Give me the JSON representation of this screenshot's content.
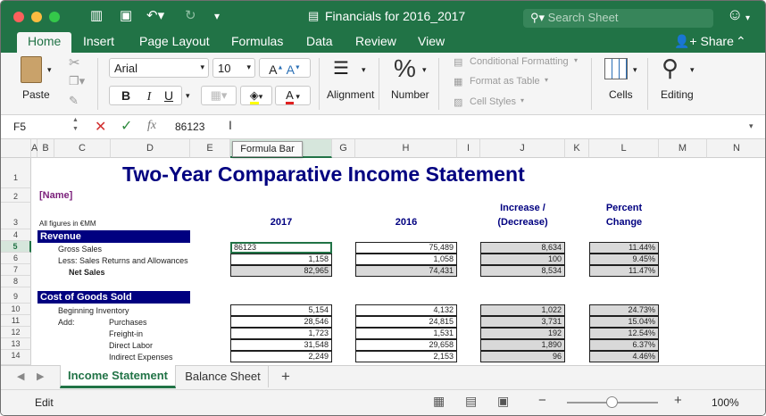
{
  "window": {
    "title": "Financials for 2016_2017",
    "search_placeholder": "Search Sheet"
  },
  "ribbon_tabs": [
    "Home",
    "Insert",
    "Page Layout",
    "Formulas",
    "Data",
    "Review",
    "View"
  ],
  "share_label": "Share",
  "ribbon": {
    "paste": "Paste",
    "font_name": "Arial",
    "font_size": "10",
    "bold": "B",
    "italic": "I",
    "underline": "U",
    "alignment": "Alignment",
    "number": "Number",
    "number_glyph": "%",
    "conditional_formatting": "Conditional Formatting",
    "format_as_table": "Format as Table",
    "cell_styles": "Cell Styles",
    "cells": "Cells",
    "editing": "Editing"
  },
  "formula_bar": {
    "name_box": "F5",
    "fx": "fx",
    "value": "86123",
    "tooltip": "Formula Bar"
  },
  "columns": [
    "A",
    "B",
    "C",
    "D",
    "E",
    "F",
    "G",
    "H",
    "I",
    "J",
    "K",
    "L",
    "M",
    "N"
  ],
  "rows": [
    "1",
    "2",
    "3",
    "4",
    "5",
    "6",
    "7",
    "8",
    "9",
    "10",
    "11",
    "12",
    "13",
    "14"
  ],
  "sheet": {
    "title": "Two-Year Comparative Income Statement",
    "name_placeholder": "[Name]",
    "note": "All figures in €MM",
    "col_2017": "2017",
    "col_2016": "2016",
    "col_increase_1": "Increase /",
    "col_increase_2": "(Decrease)",
    "col_percent_1": "Percent",
    "col_percent_2": "Change",
    "revenue_header": "Revenue",
    "cogs_header": "Cost of Goods Sold",
    "add_label": "Add:",
    "lines": [
      {
        "label": "Gross Sales",
        "y2017": "86123",
        "y2016": "75,489",
        "inc": "8,634",
        "pct": "11.44%"
      },
      {
        "label": "Less: Sales Returns and Allowances",
        "y2017": "1,158",
        "y2016": "1,058",
        "inc": "100",
        "pct": "9.45%"
      },
      {
        "label": "Net Sales",
        "y2017": "82,965",
        "y2016": "74,431",
        "inc": "8,534",
        "pct": "11.47%"
      },
      {
        "label": "Beginning Inventory",
        "y2017": "5,154",
        "y2016": "4,132",
        "inc": "1,022",
        "pct": "24.73%"
      },
      {
        "label": "Purchases",
        "y2017": "28,546",
        "y2016": "24,815",
        "inc": "3,731",
        "pct": "15.04%"
      },
      {
        "label": "Freight-in",
        "y2017": "1,723",
        "y2016": "1,531",
        "inc": "192",
        "pct": "12.54%"
      },
      {
        "label": "Direct Labor",
        "y2017": "31,548",
        "y2016": "29,658",
        "inc": "1,890",
        "pct": "6.37%"
      },
      {
        "label": "Indirect Expenses",
        "y2017": "2,249",
        "y2016": "2,153",
        "inc": "96",
        "pct": "4.46%"
      }
    ]
  },
  "sheet_tabs": [
    "Income Statement",
    "Balance Sheet"
  ],
  "add_sheet": "+",
  "status": {
    "mode": "Edit",
    "zoom": "100%",
    "minus": "−",
    "plus": "+"
  },
  "colors": {
    "excel_green": "#217346",
    "navy": "#000080"
  }
}
